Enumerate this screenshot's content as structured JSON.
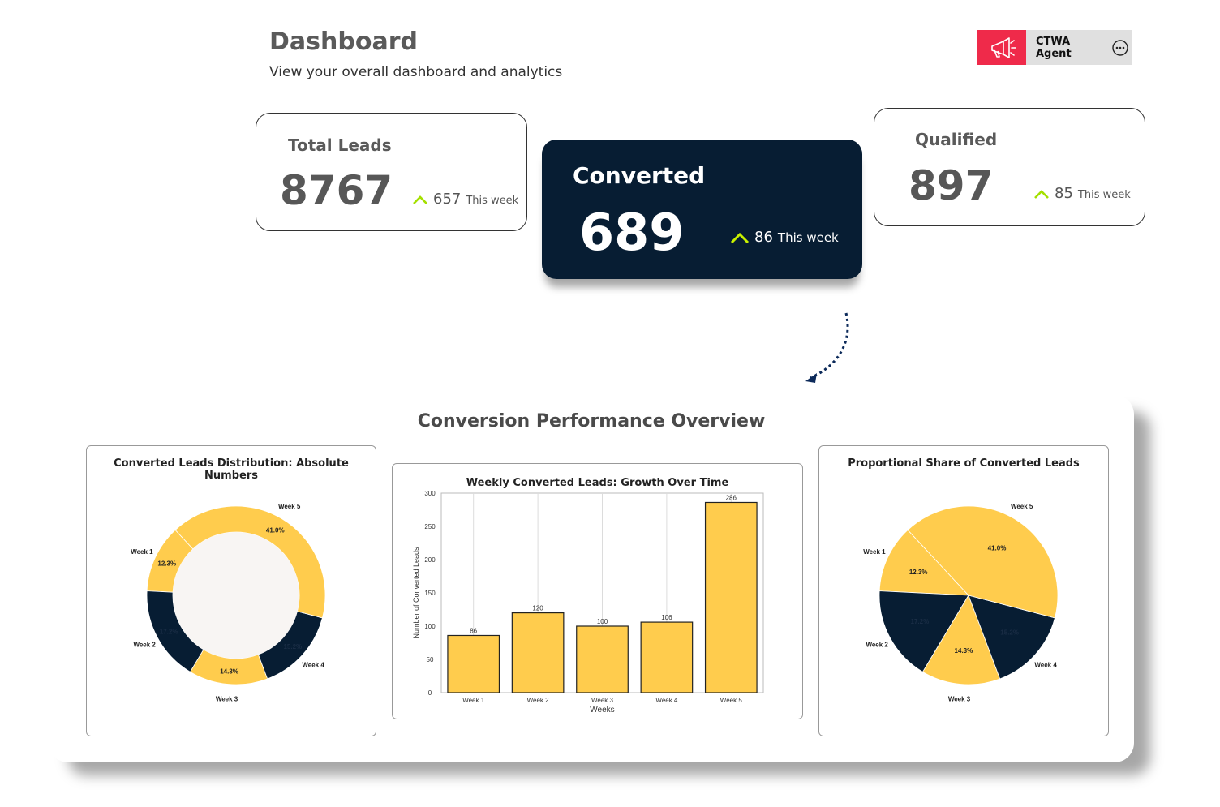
{
  "header": {
    "title": "Dashboard",
    "subtitle": "View your overall dashboard and analytics"
  },
  "agent": {
    "label": "CTWA Agent",
    "icon": "megaphone-icon",
    "menu_icon": "more-icon"
  },
  "kpis": {
    "total": {
      "title": "Total Leads",
      "value": "8767",
      "delta": "657",
      "period": "This week"
    },
    "converted": {
      "title": "Converted",
      "value": "689",
      "delta": "86",
      "period": "This week"
    },
    "qualified": {
      "title": "Qualified",
      "value": "897",
      "delta": "85",
      "period": "This week"
    }
  },
  "colors": {
    "accent_red": "#ef2a4a",
    "navy": "#071d33",
    "yellow": "#ffcc4d",
    "up_green": "#a4e000"
  },
  "overview": {
    "title": "Conversion Performance Overview"
  },
  "chart_data": [
    {
      "type": "pie",
      "variant": "donut",
      "title": "Converted Leads Distribution: Absolute Numbers",
      "labels": [
        "Week 1",
        "Week 2",
        "Week 3",
        "Week 4",
        "Week 5"
      ],
      "values": [
        12.3,
        17.2,
        14.3,
        15.2,
        41.0
      ],
      "value_labels": [
        "12.3%",
        "17.2%",
        "14.3%",
        "15.2%",
        "41.0%"
      ],
      "colors": [
        "#ffcc4d",
        "#071d33",
        "#ffcc4d",
        "#071d33",
        "#ffcc4d"
      ]
    },
    {
      "type": "bar",
      "title": "Weekly Converted Leads: Growth Over Time",
      "categories": [
        "Week 1",
        "Week 2",
        "Week 3",
        "Week 4",
        "Week 5"
      ],
      "values": [
        86,
        120,
        100,
        106,
        286
      ],
      "value_labels": [
        "86",
        "120",
        "100",
        "106",
        "286"
      ],
      "xlabel": "Weeks",
      "ylabel": "Number of Converted Leads",
      "ylim": [
        0,
        300
      ],
      "yticks": [
        0,
        50,
        100,
        150,
        200,
        250,
        300
      ],
      "grid": "x",
      "color": "#ffcc4d"
    },
    {
      "type": "pie",
      "title": "Proportional Share of Converted Leads",
      "labels": [
        "Week 1",
        "Week 2",
        "Week 3",
        "Week 4",
        "Week 5"
      ],
      "values": [
        12.3,
        17.2,
        14.3,
        15.2,
        41.0
      ],
      "value_labels": [
        "12.3%",
        "17.2%",
        "14.3%",
        "15.2%",
        "41.0%"
      ],
      "colors": [
        "#ffcc4d",
        "#071d33",
        "#ffcc4d",
        "#071d33",
        "#ffcc4d"
      ]
    }
  ]
}
